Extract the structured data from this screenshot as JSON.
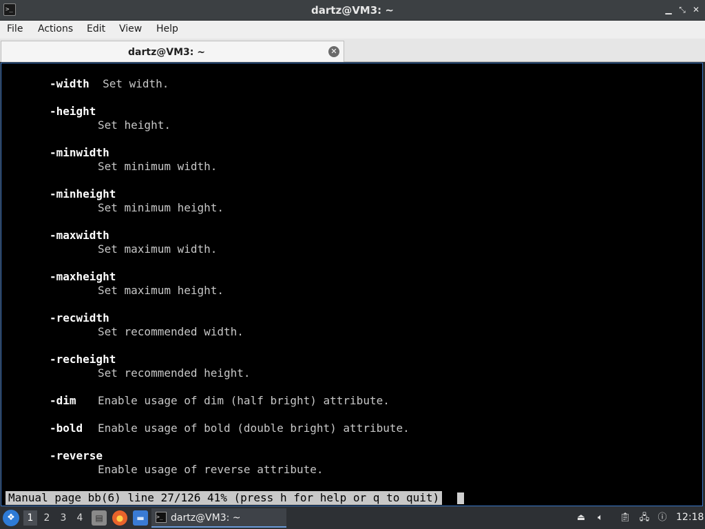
{
  "window": {
    "title": "dartz@VM3: ~",
    "app_icon": "terminal-icon",
    "controls": [
      "minimize",
      "maximize",
      "close"
    ]
  },
  "menu": {
    "items": [
      "File",
      "Actions",
      "Edit",
      "View",
      "Help"
    ]
  },
  "tabs": [
    {
      "label": "dartz@VM3: ~",
      "close_icon": "close-circle-icon"
    }
  ],
  "terminal": {
    "lines": [
      {
        "opt": "-width",
        "desc": "Set width."
      },
      {
        "opt": "-height",
        "desc": ""
      },
      {
        "opt": "",
        "desc": "Set height."
      },
      {
        "opt": "-minwidth",
        "desc": ""
      },
      {
        "opt": "",
        "desc": "Set minimum width."
      },
      {
        "opt": "-minheight",
        "desc": ""
      },
      {
        "opt": "",
        "desc": "Set minimum height."
      },
      {
        "opt": "-maxwidth",
        "desc": ""
      },
      {
        "opt": "",
        "desc": "Set maximum width."
      },
      {
        "opt": "-maxheight",
        "desc": ""
      },
      {
        "opt": "",
        "desc": "Set maximum height."
      },
      {
        "opt": "-recwidth",
        "desc": ""
      },
      {
        "opt": "",
        "desc": "Set recommended width."
      },
      {
        "opt": "-recheight",
        "desc": ""
      },
      {
        "opt": "",
        "desc": "Set recommended height."
      },
      {
        "opt": "-dim",
        "desc": "Enable usage of dim (half bright) attribute."
      },
      {
        "opt": "-bold",
        "desc": "Enable usage of bold (double bright) attribute."
      },
      {
        "opt": "-reverse",
        "desc": ""
      },
      {
        "opt": "",
        "desc": "Enable usage of reverse attribute."
      }
    ],
    "status": "Manual page bb(6) line 27/126 41% (press h for help or q to quit)"
  },
  "taskbar": {
    "start_icon": "start-menu-icon",
    "workspaces": [
      "1",
      "2",
      "3",
      "4"
    ],
    "active_workspace": "1",
    "launchers": [
      "file-manager-icon",
      "firefox-icon",
      "desktop-icon"
    ],
    "window_button": "dartz@VM3: ~",
    "tray_icons": [
      "upload-icon",
      "volume-icon",
      "clipboard-icon",
      "network-icon",
      "info-icon"
    ],
    "clock": "12:18"
  }
}
